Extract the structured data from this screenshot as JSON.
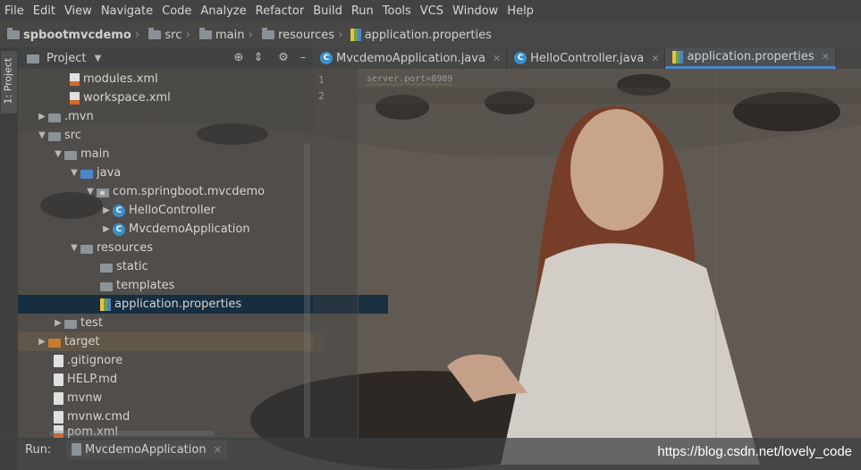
{
  "menu": [
    "File",
    "Edit",
    "View",
    "Navigate",
    "Code",
    "Analyze",
    "Refactor",
    "Build",
    "Run",
    "Tools",
    "VCS",
    "Window",
    "Help"
  ],
  "breadcrumb": {
    "project": "spbootmvcdemo",
    "items": [
      "src",
      "main",
      "resources",
      "application.properties"
    ]
  },
  "side_stripe": {
    "label": "1: Project"
  },
  "project_panel": {
    "title": "Project",
    "rows": [
      {
        "label": "modules.xml",
        "icon": "xml-file-icon"
      },
      {
        "label": "workspace.xml",
        "icon": "xml-file-icon"
      },
      {
        "label": ".mvn",
        "icon": "folder-icon",
        "arrow": "▶"
      },
      {
        "label": "src",
        "icon": "folder-icon",
        "arrow": "▼"
      },
      {
        "label": "main",
        "icon": "folder-icon",
        "arrow": "▼"
      },
      {
        "label": "java",
        "icon": "source-folder-icon",
        "arrow": "▼"
      },
      {
        "label": "com.springboot.mvcdemo",
        "icon": "package-icon",
        "arrow": "▼"
      },
      {
        "label": "HelloController",
        "icon": "class-icon",
        "arrow": "▶"
      },
      {
        "label": "MvcdemoApplication",
        "icon": "class-icon",
        "arrow": "▶"
      },
      {
        "label": "resources",
        "icon": "resources-folder-icon",
        "arrow": "▼"
      },
      {
        "label": "static",
        "icon": "folder-icon"
      },
      {
        "label": "templates",
        "icon": "folder-icon"
      },
      {
        "label": "application.properties",
        "icon": "properties-file-icon"
      },
      {
        "label": "test",
        "icon": "folder-icon",
        "arrow": "▶"
      },
      {
        "label": "target",
        "icon": "excluded-folder-icon",
        "arrow": "▶"
      },
      {
        "label": ".gitignore",
        "icon": "file-icon"
      },
      {
        "label": "HELP.md",
        "icon": "file-icon"
      },
      {
        "label": "mvnw",
        "icon": "file-icon"
      },
      {
        "label": "mvnw.cmd",
        "icon": "file-icon"
      },
      {
        "label": "pom.xml",
        "icon": "xml-file-icon"
      }
    ],
    "selected": "application.properties"
  },
  "editor_tabs": [
    {
      "label": "MvcdemoApplication.java",
      "icon": "class-icon"
    },
    {
      "label": "HelloController.java",
      "icon": "class-icon"
    },
    {
      "label": "application.properties",
      "icon": "properties-file-icon",
      "active": true
    }
  ],
  "editor": {
    "line_numbers": [
      "1",
      "2"
    ],
    "line1": "server.port=8989"
  },
  "run": {
    "label": "Run:",
    "config": "MvcdemoApplication"
  },
  "watermark": "https://blog.csdn.net/lovely_code",
  "colors": {
    "accent": "#4a88c7",
    "selection": "#0d293e",
    "background": "#3c3f41"
  }
}
